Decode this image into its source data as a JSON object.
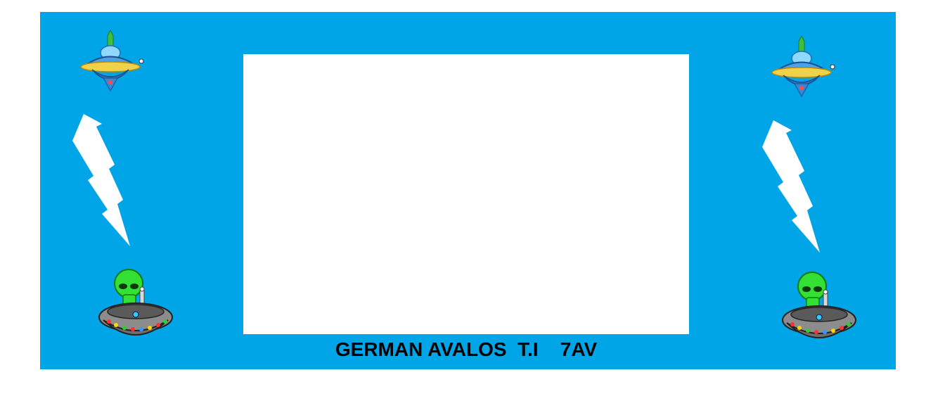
{
  "caption": "GERMAN AVALOS  T.I    7AV",
  "colors": {
    "background": "#00a5e8",
    "screen": "#ffffff",
    "caption_text": "#000000"
  },
  "icons": {
    "top_left": "flying-saucer-icon",
    "top_right": "flying-saucer-icon",
    "middle_left": "lightning-bolt-icon",
    "middle_right": "lightning-bolt-icon",
    "bottom_left": "alien-in-ufo-icon",
    "bottom_right": "alien-in-ufo-icon"
  }
}
